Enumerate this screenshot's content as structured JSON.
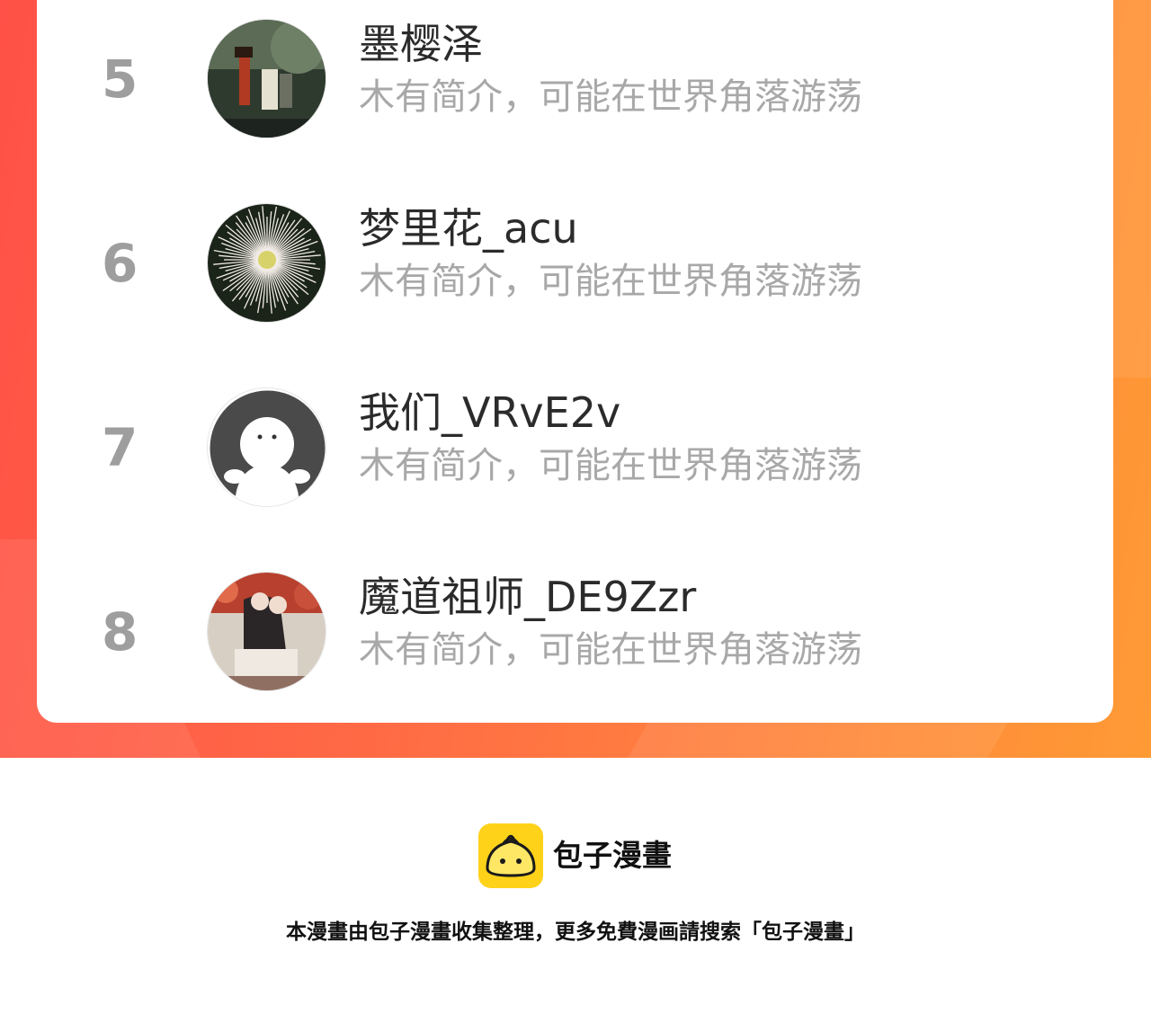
{
  "ranking": {
    "items": [
      {
        "rank": "5",
        "name": "墨樱泽",
        "bio": "木有简介，可能在世界角落游荡",
        "avatar": "landscape-photo-avatar"
      },
      {
        "rank": "6",
        "name": "梦里花_acu",
        "bio": "木有简介，可能在世界角落游荡",
        "avatar": "flower-photo-avatar"
      },
      {
        "rank": "7",
        "name": "我们_VRvE2v",
        "bio": "木有简介，可能在世界角落游荡",
        "avatar": "default-ghost-avatar"
      },
      {
        "rank": "8",
        "name": "魔道祖师_DE9Zzr",
        "bio": "木有简介，可能在世界角落游荡",
        "avatar": "illustration-avatar"
      }
    ]
  },
  "footer": {
    "brand": "包子漫畫",
    "note": "本漫畫由包子漫畫收集整理，更多免費漫画請搜索「包子漫畫」",
    "logo_icon": "bun-logo-icon"
  },
  "colors": {
    "banner_start": "#ff5147",
    "banner_end": "#ff9a35",
    "logo_yellow": "#ffd21a",
    "rank_gray": "#9e9e9e",
    "bio_gray": "#a8a8a8"
  }
}
